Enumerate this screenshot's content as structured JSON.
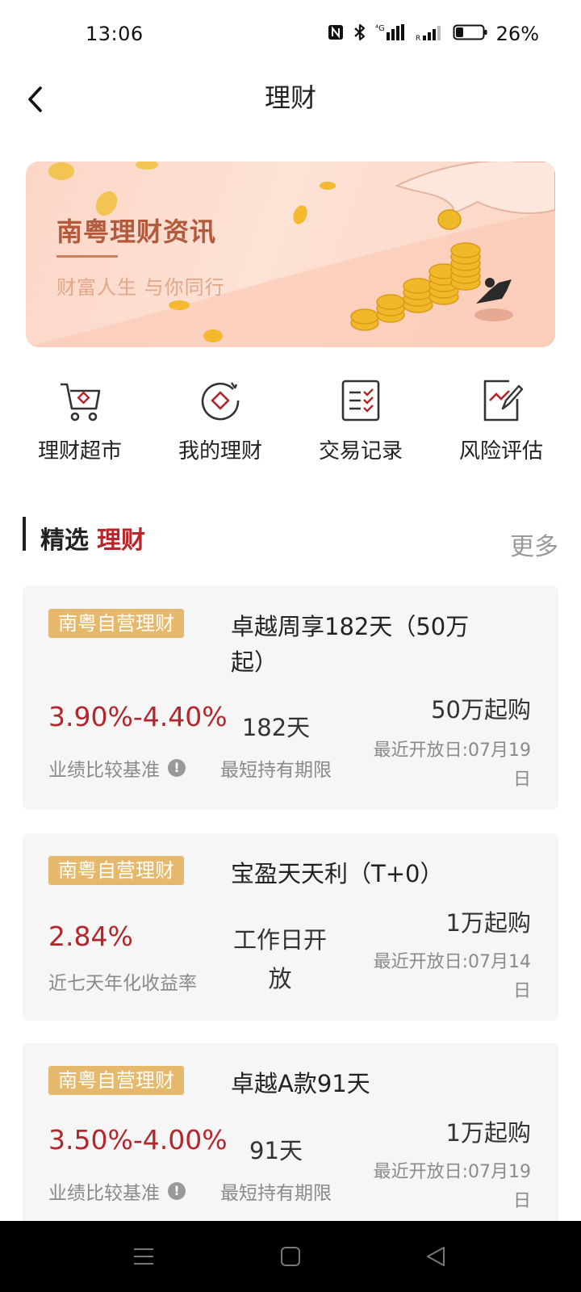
{
  "status": {
    "time": "13:06",
    "battery": "26%",
    "icons": [
      "nfc-icon",
      "bluetooth-icon",
      "4g-signal-icon",
      "signal-icon",
      "battery-icon"
    ]
  },
  "header": {
    "title": "理财",
    "back_icon": "chevron-left-icon"
  },
  "banner": {
    "title": "南粤理财资讯",
    "subtitle": "财富人生 与你同行"
  },
  "quick_nav": [
    {
      "label": "理财超市",
      "icon": "cart-icon"
    },
    {
      "label": "我的理财",
      "icon": "target-icon"
    },
    {
      "label": "交易记录",
      "icon": "checklist-icon"
    },
    {
      "label": "风险评估",
      "icon": "chart-edit-icon"
    }
  ],
  "section": {
    "title": "精选",
    "title_accent": "理财",
    "more": "更多"
  },
  "products": [
    {
      "tag": "南粤自营理财",
      "name": "卓越周享182天（50万起）",
      "rate": "3.90%-4.40%",
      "rate_label": "业绩比较基准",
      "term": "182天",
      "term_label": "最短持有期限",
      "min_buy": "50万起购",
      "open_date": "最近开放日:07月19日"
    },
    {
      "tag": "南粤自营理财",
      "name": "宝盈天天利（T+0）",
      "rate": "2.84%",
      "rate_label": "近七天年化收益率",
      "term": "工作日开放",
      "term_label": "",
      "min_buy": "1万起购",
      "open_date": "最近开放日:07月14日"
    },
    {
      "tag": "南粤自营理财",
      "name": "卓越A款91天",
      "rate": "3.50%-4.00%",
      "rate_label": "业绩比较基准",
      "term": "91天",
      "term_label": "最短持有期限",
      "min_buy": "1万起购",
      "open_date": "最近开放日:07月19日"
    }
  ],
  "colors": {
    "accent_red": "#b3262b",
    "tag_gold": "#e5b86c",
    "banner_title": "#b35a3c"
  }
}
